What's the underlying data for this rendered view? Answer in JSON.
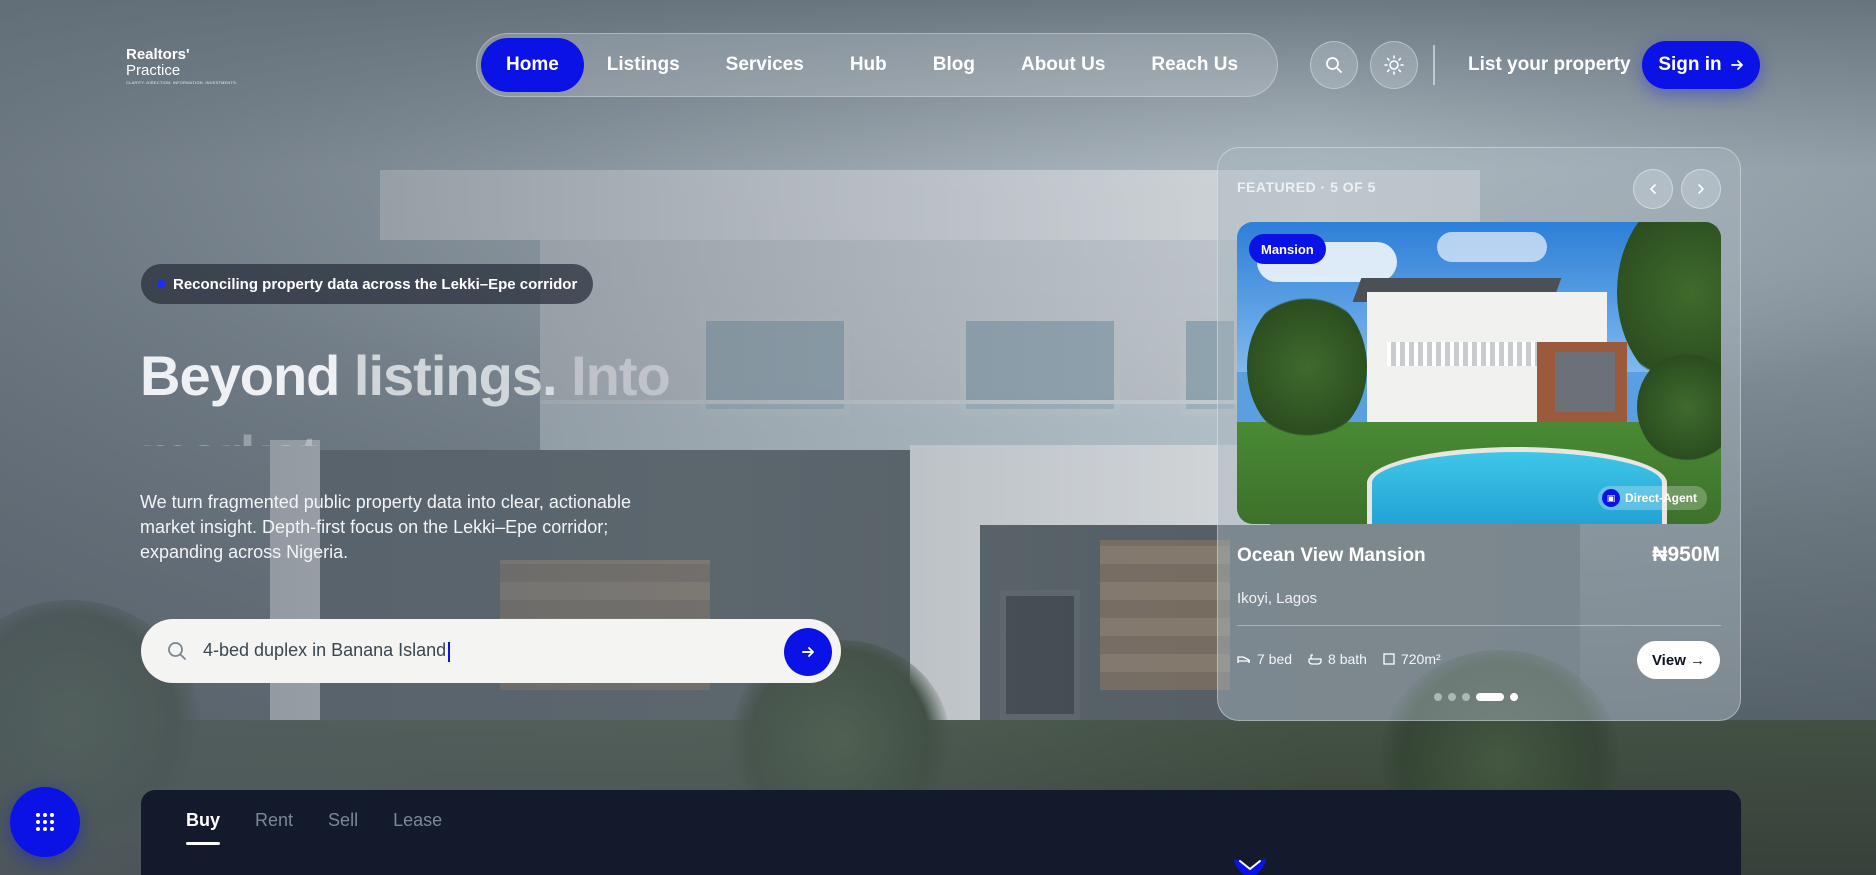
{
  "brand": {
    "line1": "Realtors'",
    "line2": "Practice",
    "tagline": "CLARITY. DIRECTION. INFORMATION. INVESTMENTS."
  },
  "nav": {
    "items": [
      {
        "label": "Home",
        "active": true
      },
      {
        "label": "Listings",
        "active": false
      },
      {
        "label": "Services",
        "active": false
      },
      {
        "label": "Hub",
        "active": false
      },
      {
        "label": "Blog",
        "active": false
      },
      {
        "label": "About Us",
        "active": false
      },
      {
        "label": "Reach Us",
        "active": false
      }
    ],
    "search_icon": "search-icon",
    "theme_icon": "sun-icon",
    "list_property": "List your property",
    "sign_in": "Sign in"
  },
  "hero": {
    "status_pill": "Reconciling property data across the Lekki–Epe corridor",
    "headline": [
      "Beyond",
      "listings.",
      "Into",
      "market"
    ],
    "lead": "We turn fragmented public property data into clear, actionable market insight. Depth-first focus on the Lekki–Epe corridor; expanding across Nigeria.",
    "search_value": "4-bed duplex in Banana Island"
  },
  "featured": {
    "label": "FEATURED · 5 OF 5",
    "badge": "Mansion",
    "agent": "Direct-Agent",
    "title": "Ocean View Mansion",
    "price": "₦950M",
    "location": "Ikoyi, Lagos",
    "beds": "7 bed",
    "baths": "8 bath",
    "area": "720m²",
    "view_label": "View →",
    "slide_count": 5,
    "active_slide": 4
  },
  "tabs": [
    {
      "label": "Buy",
      "active": true
    },
    {
      "label": "Rent",
      "active": false
    },
    {
      "label": "Sell",
      "active": false
    },
    {
      "label": "Lease",
      "active": false
    }
  ],
  "colors": {
    "accent": "#0a12e6",
    "panel": "#121a2b"
  }
}
